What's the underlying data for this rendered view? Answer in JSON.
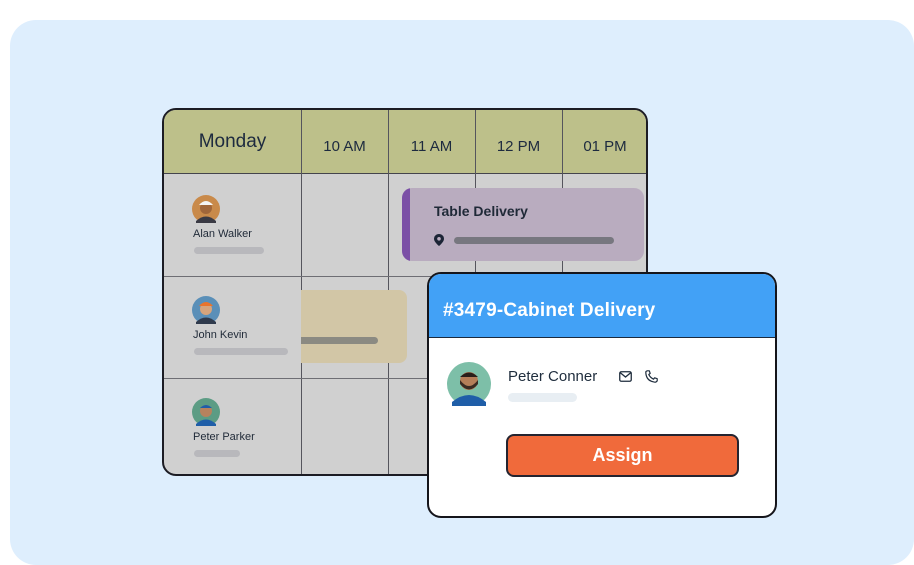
{
  "schedule": {
    "day_label": "Monday",
    "time_slots": [
      "10 AM",
      "11 AM",
      "12 PM",
      "01 PM"
    ],
    "rows": [
      {
        "name": "Alan Walker"
      },
      {
        "name": "John Kevin"
      },
      {
        "name": "Peter Parker"
      }
    ],
    "events": {
      "table_delivery": {
        "title": "Table Delivery",
        "accent_color": "#7b4fa6"
      }
    }
  },
  "job_card": {
    "title": "#3479-Cabinet Delivery",
    "assignee": {
      "name": "Peter Conner"
    },
    "assign_label": "Assign",
    "header_color": "#42a1f6",
    "button_color": "#f06a3b"
  }
}
